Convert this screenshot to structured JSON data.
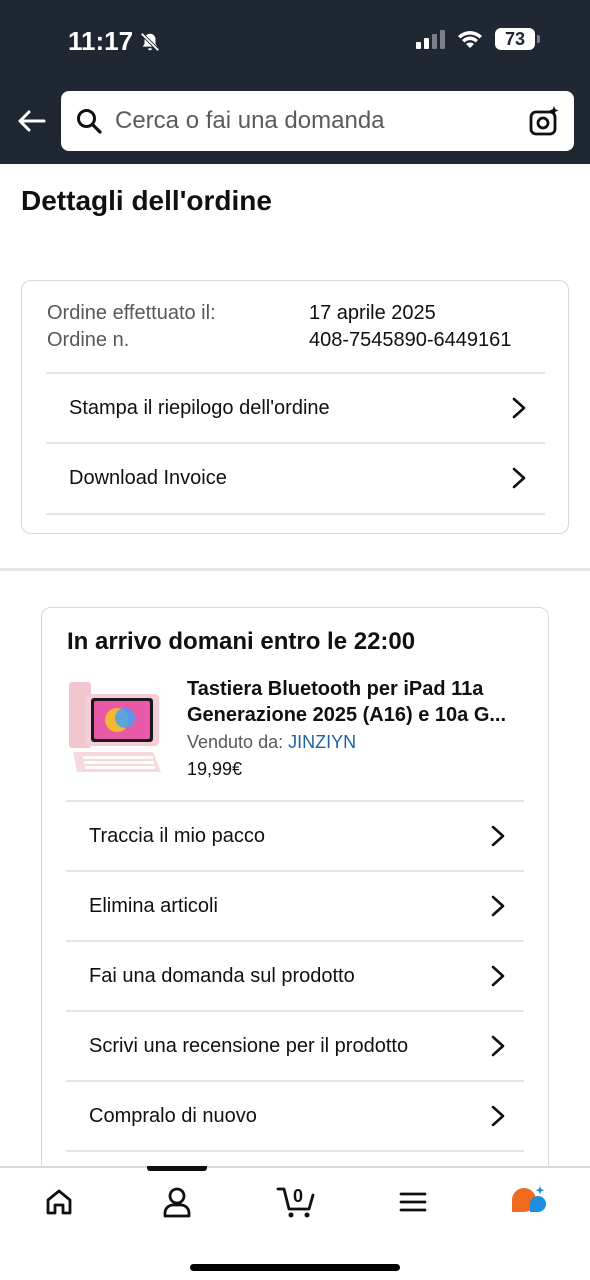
{
  "status_bar": {
    "time": "11:17",
    "battery": "73"
  },
  "search": {
    "placeholder": "Cerca o fai una domanda"
  },
  "page": {
    "title": "Dettagli dell'ordine"
  },
  "order": {
    "placed_label": "Ordine effettuato il:",
    "placed_value": "17 aprile 2025",
    "number_label": "Ordine n.",
    "number_value": "408-7545890-6449161",
    "links": [
      {
        "label": "Stampa il riepilogo dell'ordine"
      },
      {
        "label": "Download Invoice"
      }
    ]
  },
  "shipment": {
    "title": "In arrivo domani entro le 22:00",
    "product_title": "Tastiera Bluetooth per iPad 11a Generazione 2025 (A16) e 10a G...",
    "seller_label": "Venduto da:",
    "seller_name": "JINZIYN",
    "price": "19,99€",
    "actions": [
      {
        "label": "Traccia il mio pacco"
      },
      {
        "label": "Elimina articoli"
      },
      {
        "label": "Fai una domanda sul prodotto"
      },
      {
        "label": "Scrivi una recensione per il prodotto"
      },
      {
        "label": "Compralo di nuovo"
      }
    ]
  },
  "bottom_nav": {
    "cart_count": "0",
    "items": [
      "home-icon",
      "account-icon",
      "cart-icon",
      "menu-icon",
      "rufus-ai-icon"
    ]
  },
  "colors": {
    "header": "#1f2732",
    "link": "#2162a1",
    "border": "#d5d9d9"
  }
}
